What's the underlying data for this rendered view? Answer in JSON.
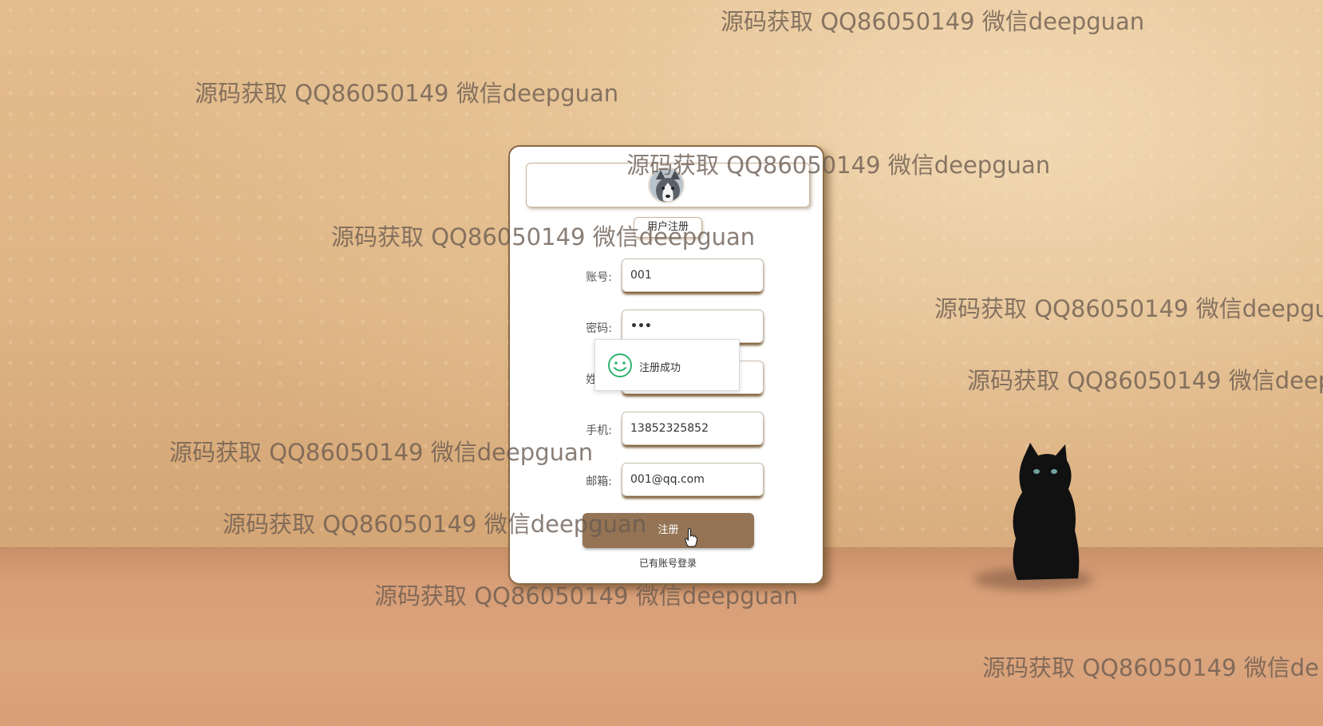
{
  "form": {
    "title": "用户注册",
    "fields": [
      {
        "label": "账号:",
        "value": "001"
      },
      {
        "label": "密码:",
        "value": "•••"
      },
      {
        "label": "姓名:",
        "value": ""
      },
      {
        "label": "手机:",
        "value": "13852325852"
      },
      {
        "label": "邮箱:",
        "value": "001@qq.com"
      }
    ],
    "submit_label": "注册",
    "login_link": "已有账号登录"
  },
  "toast": {
    "icon": "smile-icon",
    "message": "注册成功",
    "color": "#2fb36e"
  },
  "watermarks": [
    "源码获取 QQ86050149 微信deepguan",
    "源码获取 QQ86050149 微信deepguan",
    "源码获取 QQ86050149 微信deepguan",
    "源码获取 QQ86050149 微信deepguan",
    "源码获取 QQ86050149 微信deepgu",
    "源码获取 QQ86050149 微信deep",
    "源码获取 QQ86050149 微信deepguan",
    "源码获取 QQ86050149 微信deepguan",
    "源码获取 QQ86050149 微信deepguan",
    "源码获取 QQ86050149 微信de"
  ],
  "colors": {
    "button": "#947454",
    "card_border": "#8a6a44"
  }
}
